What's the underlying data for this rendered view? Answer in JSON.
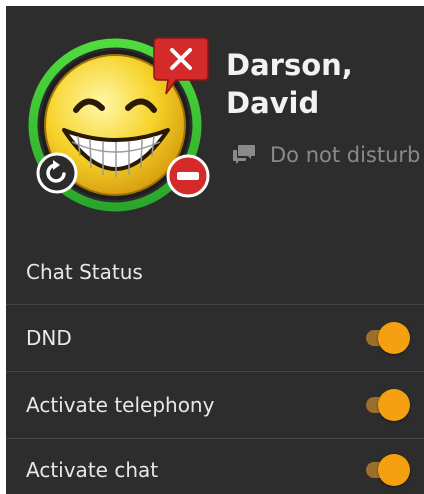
{
  "contact": {
    "first_line": "Darson,",
    "second_line": "David",
    "presence": "Do not disturb"
  },
  "settings": {
    "section_title": "Chat Status",
    "rows": [
      {
        "label": "DND",
        "enabled": true
      },
      {
        "label": "Activate telephony",
        "enabled": true
      },
      {
        "label": "Activate chat",
        "enabled": true
      }
    ]
  },
  "colors": {
    "panel_bg": "#2d2d2d",
    "ring_green": "#3cc832",
    "toggle_on": "#f5a010",
    "status_red": "#d42a2a"
  },
  "icons": {
    "avatar": "laughing-smiley-icon",
    "close": "close-icon",
    "sync": "sync-icon",
    "dnd": "do-not-disturb-icon",
    "chat": "chat-bubble-icon"
  }
}
